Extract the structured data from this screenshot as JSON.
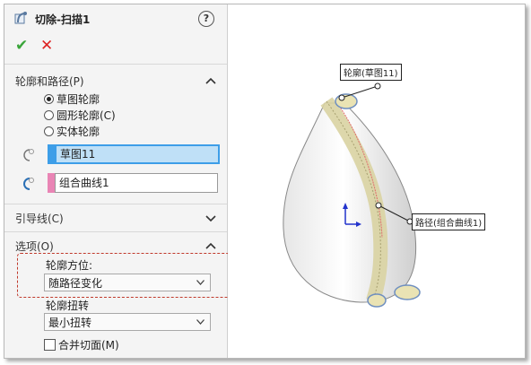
{
  "title": "切除-扫描1",
  "help_label": "?",
  "ok_symbol": "✔",
  "cancel_symbol": "✕",
  "sections": {
    "profile_path": {
      "title": "轮廓和路径(P)",
      "radios": [
        {
          "label": "草图轮廓",
          "checked": true
        },
        {
          "label": "圆形轮廓(C)",
          "checked": false
        },
        {
          "label": "实体轮廓",
          "checked": false
        }
      ],
      "profile_value": "草图11",
      "path_value": "组合曲线1"
    },
    "guide_curves": {
      "title": "引导线(C)"
    },
    "options": {
      "title": "选项(O)",
      "orientation_label": "轮廓方位:",
      "orientation_value": "随路径变化",
      "twist_label": "轮廓扭转",
      "twist_value": "最小扭转",
      "merge_label": "合并切面(M)",
      "merge_checked": false
    }
  },
  "viewport": {
    "callout_profile": "轮廓(草图11)",
    "callout_path": "路径(组合曲线1)"
  },
  "colors": {
    "profile_swatch": "#3d9ee8",
    "path_swatch": "#e985b5",
    "dashed_highlight": "#c0392b"
  }
}
